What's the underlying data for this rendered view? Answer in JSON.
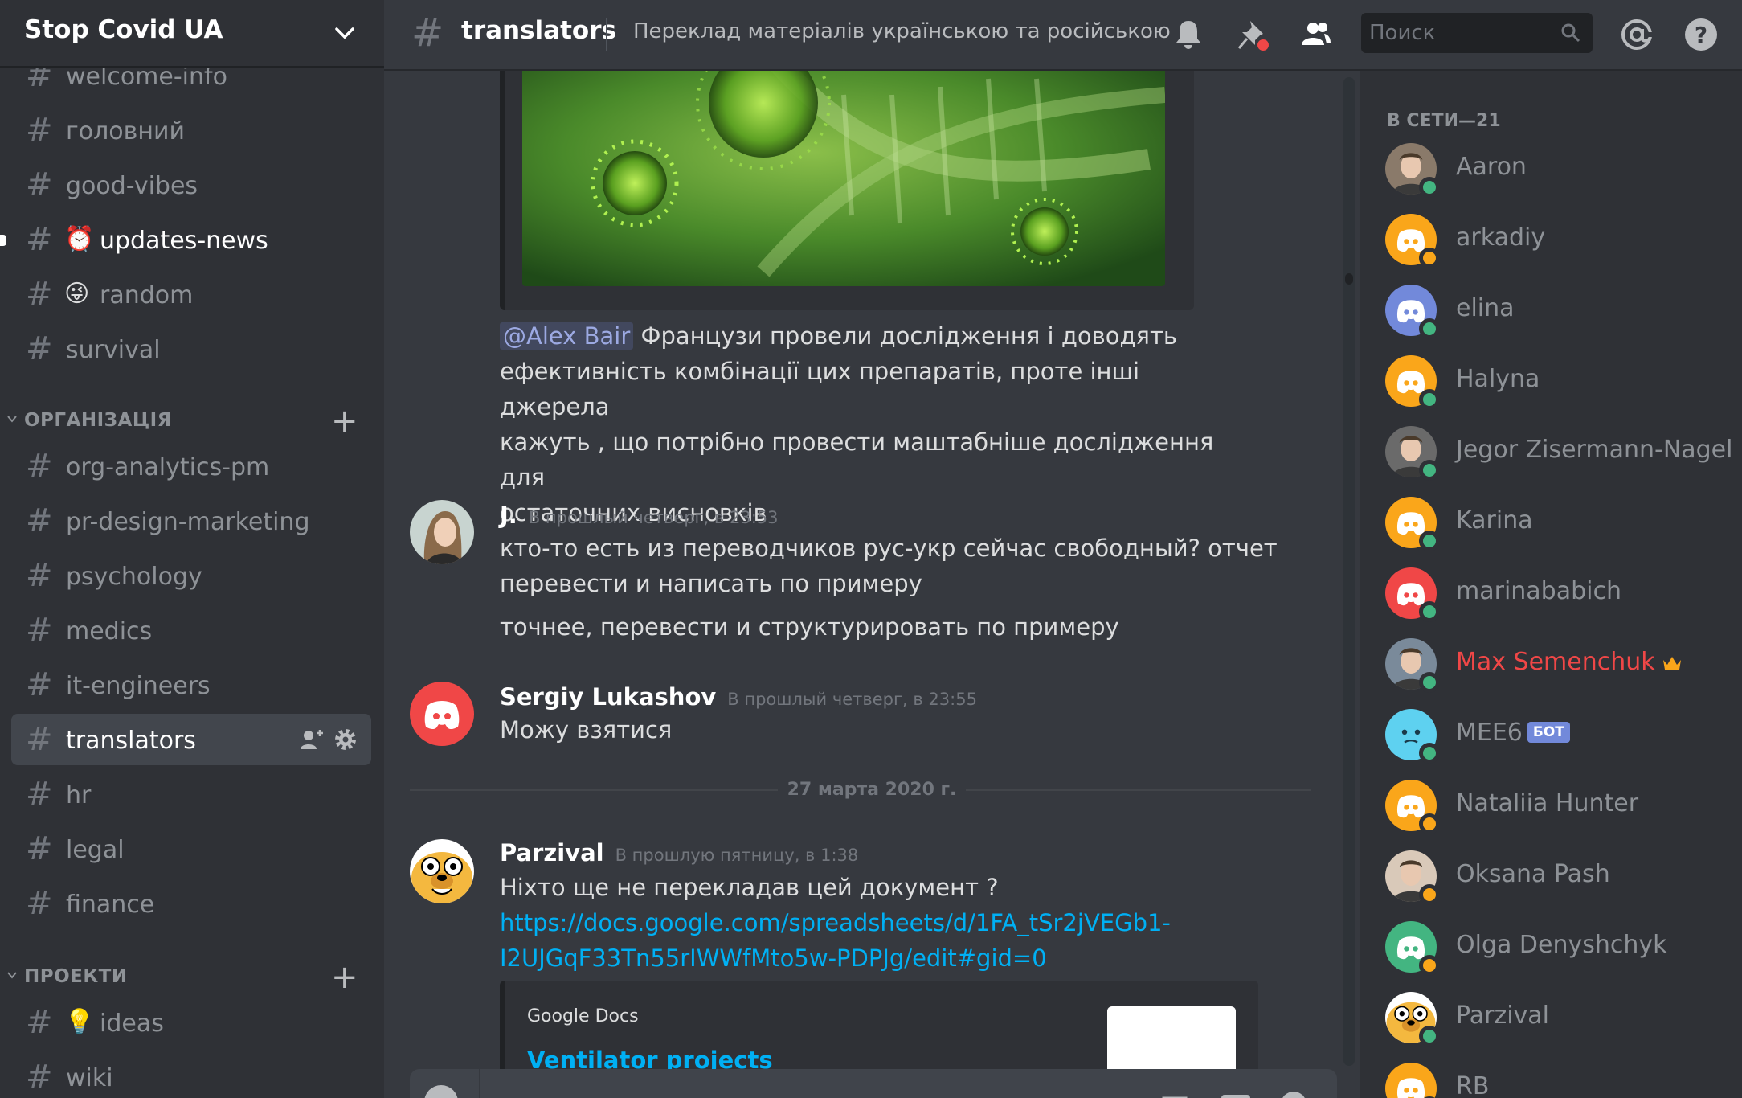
{
  "server": {
    "name": "Stop Covid UA"
  },
  "sidebar": {
    "channels_top": [
      {
        "name": "welcome-info",
        "emoji": ""
      },
      {
        "name": "головний",
        "emoji": ""
      },
      {
        "name": "good-vibes",
        "emoji": ""
      },
      {
        "name": "updates-news",
        "emoji": "⏰"
      },
      {
        "name": "random",
        "emoji": "😜"
      },
      {
        "name": "survival",
        "emoji": ""
      }
    ],
    "category_org": "ОРГАНІЗАЦІЯ",
    "channels_org": [
      {
        "name": "org-analytics-pm"
      },
      {
        "name": "pr-design-marketing"
      },
      {
        "name": "psychology"
      },
      {
        "name": "medics"
      },
      {
        "name": "it-engineers"
      },
      {
        "name": "translators"
      },
      {
        "name": "hr"
      },
      {
        "name": "legal"
      },
      {
        "name": "finance"
      }
    ],
    "category_projects": "ПРОЕКТИ",
    "channels_projects": [
      {
        "name": "ideas",
        "emoji": "💡"
      },
      {
        "name": "wiki",
        "emoji": ""
      }
    ]
  },
  "topbar": {
    "channel": "translators",
    "topic": "Переклад матеріалів українською та російською",
    "search_placeholder": "Поиск"
  },
  "messages": [
    {
      "text": "Французи провели дослідження і доводять ефективність комбінації цих препаратів, проте  інші джерела кажуть , що потрібно провести маштабніше дослідження для остаточних висновків",
      "mention": "@Alex Bair",
      "lines": [
        "Французи провели дослідження і доводять",
        "ефективність комбінації цих препаратів, проте  інші джерела",
        "кажуть , що потрібно провести маштабніше дослідження для",
        "остаточних висновків"
      ]
    },
    {
      "author": "J.",
      "timestamp": "В прошлый четверг, в 23:53",
      "lines": [
        "кто-то есть из переводчиков рус-укр сейчас свободный? отчет",
        "перевести и написать по примеру"
      ],
      "extra": "точнее, перевести и структурировать по примеру"
    },
    {
      "author": "Sergiy Lukashov",
      "timestamp": "В прошлый четверг, в 23:55",
      "lines": [
        "Можу взятися"
      ]
    },
    {
      "author": "Parzival",
      "timestamp": "В прошлую пятницу, в 1:38",
      "lines": [
        "Ніхто ще не перекладав цей документ ?"
      ],
      "link_lines": [
        "https://docs.google.com/spreadsheets/d/1FA_tSr2jVEGb1-",
        "I2UJGqF33Tn55rIWWfMto5w-PDPJg/edit#gid=0"
      ],
      "embed": {
        "provider": "Google Docs",
        "title": "Ventilator projects"
      }
    }
  ],
  "date_divider": "27 марта 2020 г.",
  "members": {
    "header": "В СЕТИ—21",
    "list": [
      {
        "name": "Aaron",
        "status": "online",
        "avatar": "photo",
        "color": "#8a7a6a"
      },
      {
        "name": "arkadiy",
        "status": "idle",
        "avatar": "discord",
        "color": "#faa61a"
      },
      {
        "name": "elina",
        "status": "online",
        "avatar": "discord",
        "color": "#7289da"
      },
      {
        "name": "Halyna",
        "status": "online",
        "avatar": "discord",
        "color": "#faa61a"
      },
      {
        "name": "Jegor Zisermann-Nagel",
        "status": "online",
        "avatar": "photo",
        "color": "#6a6a6a"
      },
      {
        "name": "Karina",
        "status": "online",
        "avatar": "discord",
        "color": "#faa61a"
      },
      {
        "name": "marinababich",
        "status": "online",
        "avatar": "discord",
        "color": "#f04747"
      },
      {
        "name": "Max Semenchuk",
        "status": "online",
        "avatar": "photo",
        "color": "#7a8a9a",
        "owner": true
      },
      {
        "name": "MEE6",
        "status": "online",
        "avatar": "mee6",
        "color": "#5ed1f0",
        "bot": "БОТ"
      },
      {
        "name": "Nataliia Hunter",
        "status": "idle",
        "avatar": "discord",
        "color": "#faa61a"
      },
      {
        "name": "Oksana Pash",
        "status": "idle",
        "avatar": "photo",
        "color": "#d9c9b9"
      },
      {
        "name": "Olga Denyshchyk",
        "status": "idle",
        "avatar": "discord",
        "color": "#43b581"
      },
      {
        "name": "Parzival",
        "status": "online",
        "avatar": "jake",
        "color": "#f4b83f"
      },
      {
        "name": "RB",
        "status": "online",
        "avatar": "discord",
        "color": "#faa61a"
      }
    ]
  }
}
